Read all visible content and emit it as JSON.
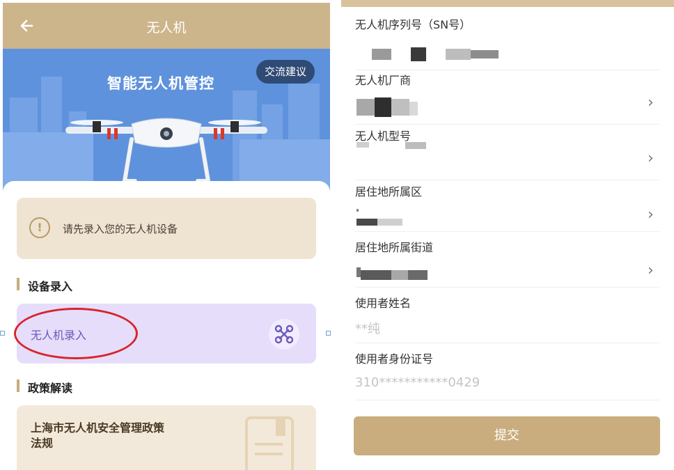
{
  "left_app": {
    "title": "无人机",
    "back_icon": "arrow-left-icon",
    "banner": {
      "title": "智能无人机管控",
      "feedback_label": "交流建议"
    },
    "notice": {
      "icon": "exclamation-icon",
      "text": "请先录入您的无人机设备"
    },
    "section_device": "设备录入",
    "entry_label": "无人机录入",
    "entry_icon": "drone-icon",
    "section_policy": "政策解读",
    "policy_title": "上海市无人机安全管理政策法规"
  },
  "form": {
    "sn": {
      "label": "无人机序列号（SN号）"
    },
    "manufacturer": {
      "label": "无人机厂商"
    },
    "model": {
      "label": "无人机型号"
    },
    "district": {
      "label": "居住地所属区"
    },
    "street": {
      "label": "居住地所属街道"
    },
    "user_name": {
      "label": "使用者姓名",
      "value": "**纯"
    },
    "user_id": {
      "label": "使用者身份证号",
      "value": "310***********0429"
    },
    "submit_label": "提交",
    "chevron_icon": "chevron-right-icon"
  },
  "colors": {
    "accent_gold": "#cdb58b",
    "banner_blue": "#5f92dd",
    "entry_purple": "#e6ddfb",
    "highlight_red": "#d8242a"
  }
}
